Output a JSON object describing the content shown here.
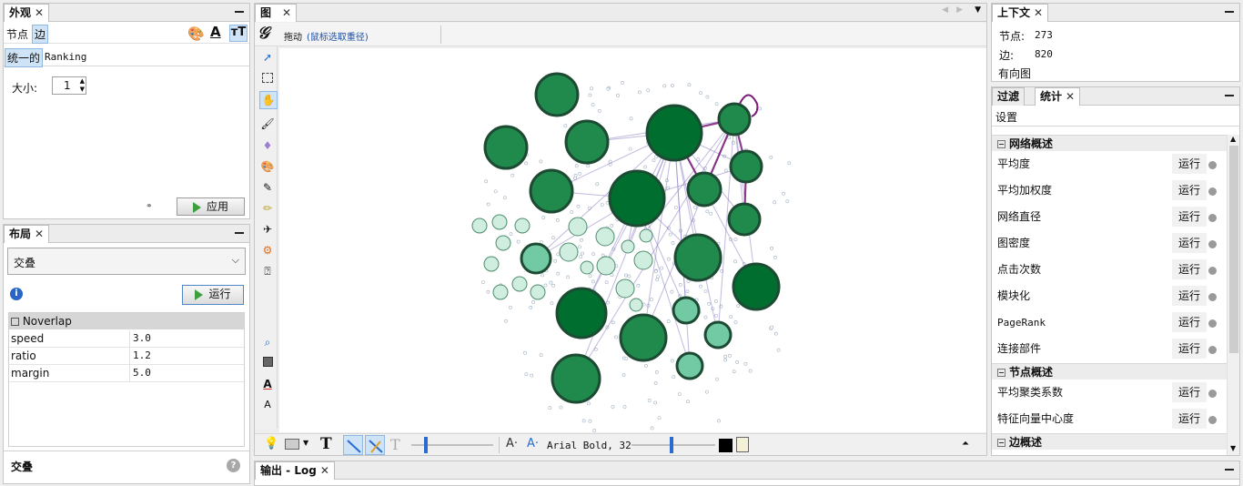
{
  "appearance": {
    "tab_title": "外观",
    "tab_nodes": "节点",
    "tab_edges": "边",
    "mode_unique": "统一的",
    "mode_ranking": "Ranking",
    "size_label": "大小:",
    "size_value": "1",
    "apply_label": "应用"
  },
  "layout": {
    "tab_title": "布局",
    "algorithm": "交叠",
    "run_label": "运行",
    "section": "Noverlap",
    "properties": [
      {
        "key": "speed",
        "value": "3.0"
      },
      {
        "key": "ratio",
        "value": "1.2"
      },
      {
        "key": "margin",
        "value": "5.0"
      }
    ],
    "footer_title": "交叠"
  },
  "graph": {
    "tab_title": "图",
    "mode_label": "拖动",
    "mode_hint": "(鼠标选取重径)",
    "font_label": "Arial Bold, 32"
  },
  "context": {
    "tab_title": "上下文",
    "nodes_label": "节点:",
    "nodes_value": "273",
    "edges_label": "边:",
    "edges_value": "820",
    "graph_type": "有向图"
  },
  "statistics": {
    "tab_filters": "过滤",
    "tab_stats": "统计",
    "settings_label": "设置",
    "sections": [
      {
        "title": "网络概述",
        "items": [
          "平均度",
          "平均加权度",
          "网络直径",
          "图密度",
          "点击次数",
          "模块化",
          "PageRank",
          "连接部件"
        ]
      },
      {
        "title": "节点概述",
        "items": [
          "平均聚类系数",
          "特征向量中心度"
        ]
      },
      {
        "title": "边概述",
        "items": []
      }
    ],
    "run_label": "运行"
  },
  "output": {
    "tab_title": "输出 - Log"
  },
  "colors": {
    "node_dark": "#006e2e",
    "node_mid": "#1f8a4c",
    "node_light": "#72caa5",
    "edge": "#8c80c4",
    "edge_strong": "#7a1a7a"
  }
}
